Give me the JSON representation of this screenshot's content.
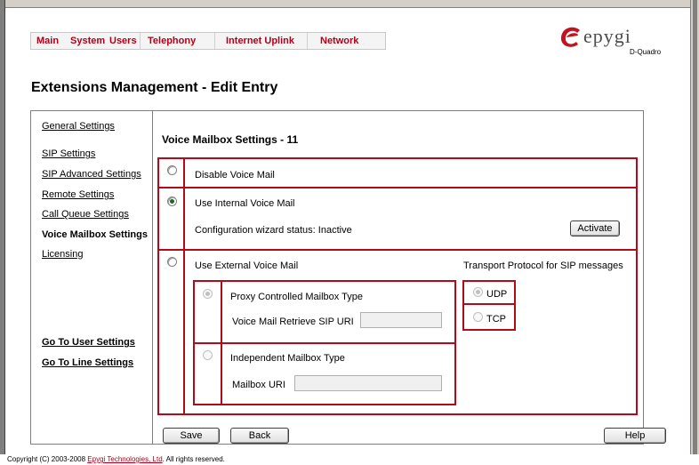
{
  "menu": {
    "items": [
      "Main",
      "System",
      "Users",
      "Telephony",
      "Internet Uplink",
      "Network"
    ]
  },
  "logo": {
    "text": "epygi",
    "sub": "D-Quadro"
  },
  "page": {
    "title": "Extensions Management - Edit Entry"
  },
  "sidebar": {
    "items": [
      "General Settings",
      "SIP Settings",
      "SIP Advanced Settings",
      "Remote Settings",
      "Call Queue Settings",
      "Voice Mailbox Settings",
      "Licensing"
    ],
    "active": "Voice Mailbox Settings",
    "goto_user": "Go To User Settings",
    "goto_line": "Go To Line Settings"
  },
  "content": {
    "section_title": "Voice Mailbox Settings - 11",
    "disable_label": "Disable Voice Mail",
    "internal_label": "Use Internal Voice Mail",
    "wizard_status": "Configuration wizard status: Inactive",
    "activate_button": "Activate",
    "external_label": "Use External Voice Mail",
    "transport_title": "Transport Protocol for SIP messages",
    "proxy_label": "Proxy Controlled Mailbox Type",
    "retrieve_label": "Voice Mail Retrieve SIP URI",
    "retrieve_value": "",
    "independent_label": "Independent Mailbox Type",
    "mailbox_uri_label": "Mailbox URI",
    "mailbox_uri_value": "",
    "udp_label": "UDP",
    "tcp_label": "TCP",
    "selected_option": "Use Internal Voice Mail"
  },
  "buttons": {
    "save": "Save",
    "back": "Back",
    "help": "Help"
  },
  "footer": {
    "prefix": "Copyright (C) 2003-2008 ",
    "link": "Epygi Technologies, Ltd",
    "suffix": ". All rights reserved."
  },
  "colors": {
    "accent": "#b10a18",
    "menu_text": "#b10018",
    "radio_checked": "#1c6b1c"
  }
}
